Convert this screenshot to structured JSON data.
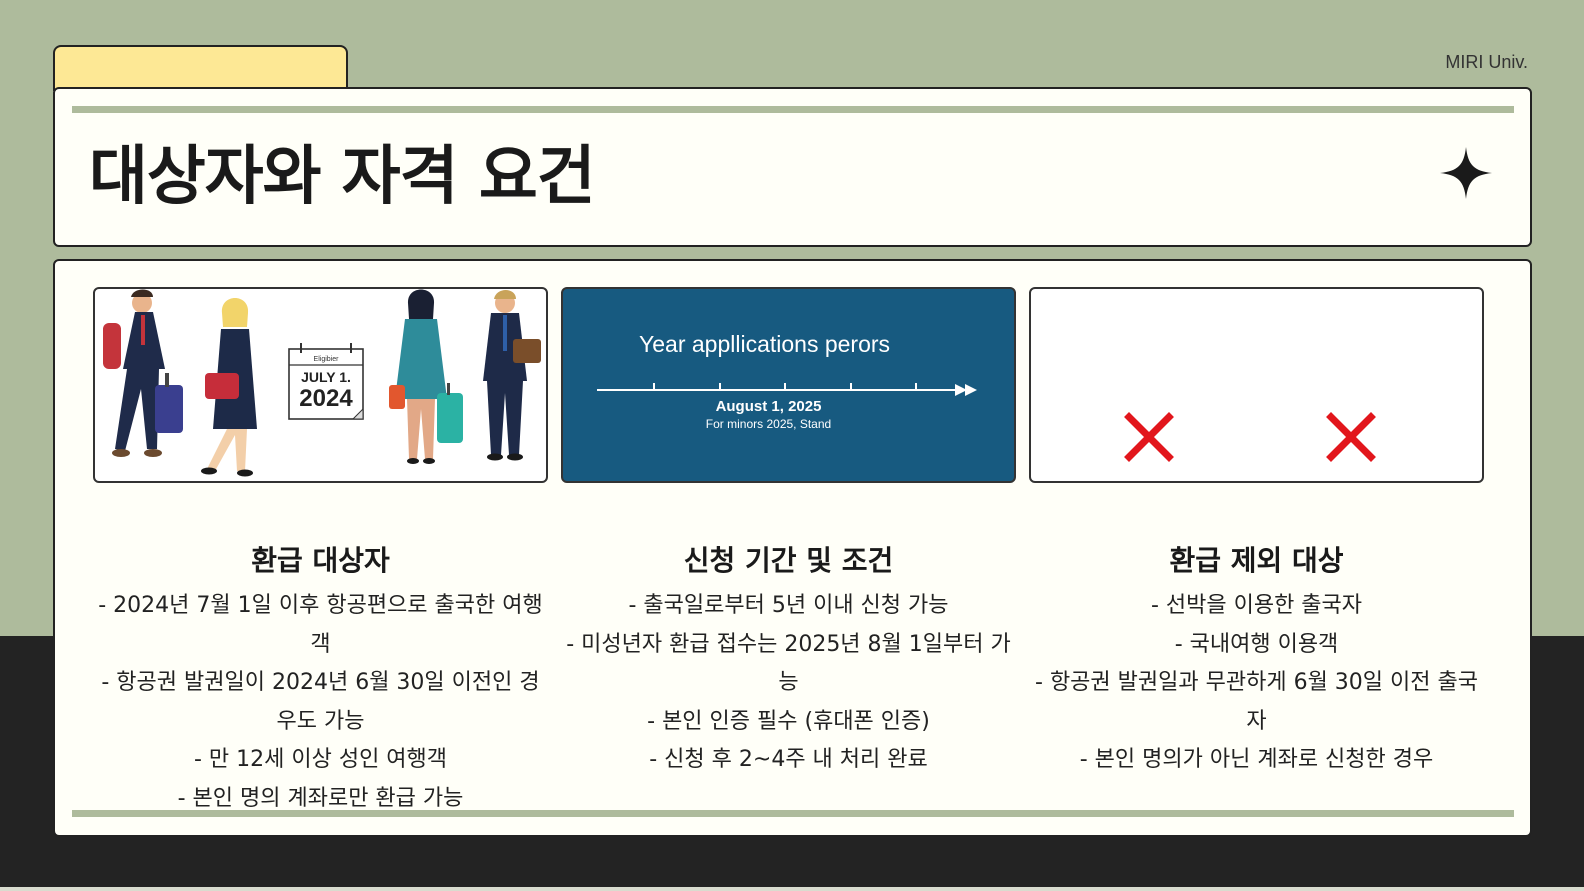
{
  "brand": "MIRI Univ.",
  "title": "대상자와 자격 요건",
  "images": {
    "calendar": {
      "label": "Eligibier",
      "date_line": "JULY 1.",
      "year": "2024"
    },
    "timeline": {
      "title": "Year appllications perors",
      "date": "August 1, 2025",
      "subtitle": "For minors 2025, Stand"
    }
  },
  "columns": [
    {
      "heading": "환급 대상자",
      "items": [
        "- 2024년 7월 1일 이후 항공편으로 출국한 여행객",
        "- 항공권 발권일이 2024년 6월 30일 이전인 경우도 가능",
        "- 만 12세 이상 성인 여행객",
        "- 본인 명의 계좌로만 환급 가능"
      ]
    },
    {
      "heading": "신청 기간 및 조건",
      "items": [
        "- 출국일로부터 5년 이내 신청 가능",
        "- 미성년자 환급 접수는 2025년 8월 1일부터 가능",
        "- 본인 인증 필수 (휴대폰 인증)",
        "- 신청 후 2~4주 내 처리 완료"
      ]
    },
    {
      "heading": "환급 제외 대상",
      "items": [
        "- 선박을 이용한 출국자",
        "- 국내여행 이용객",
        "- 항공권 발권일과 무관하게 6월 30일 이전 출국자",
        "- 본인 명의가 아닌 계좌로 신청한 경우"
      ]
    }
  ],
  "colors": {
    "background": "#aebb9c",
    "tab": "#fde895",
    "card": "#fffff8",
    "timeline_bg": "#175a80",
    "x_mark": "#e2161c",
    "bottom_band": "#232323"
  }
}
